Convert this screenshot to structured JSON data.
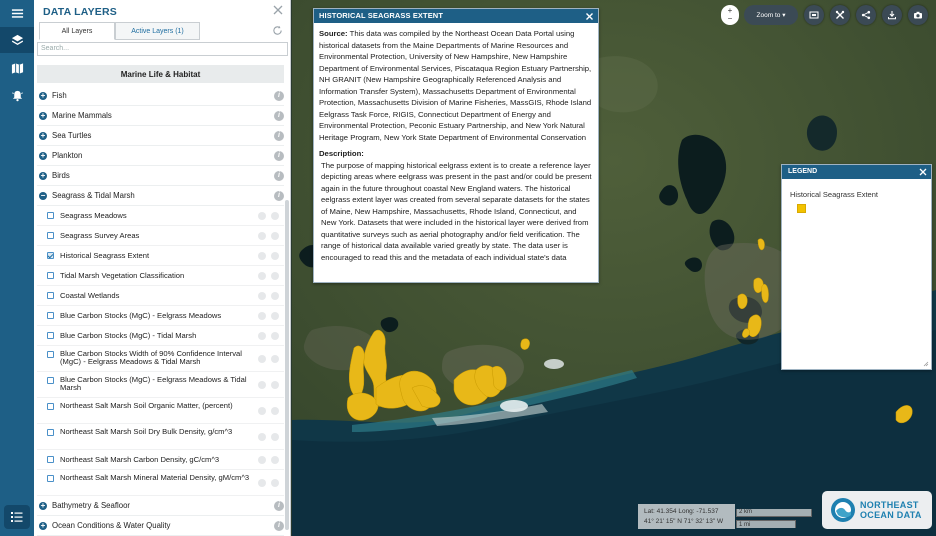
{
  "panel": {
    "title": "DATA LAYERS",
    "tabs": [
      "All Layers",
      "Active Layers (1)"
    ],
    "search_placeholder": "Search...",
    "category_header": "Marine Life & Habitat",
    "categories_top": [
      "Fish",
      "Marine Mammals",
      "Sea Turtles",
      "Plankton",
      "Birds"
    ],
    "expanded_category": "Seagrass & Tidal Marsh",
    "sublayers": [
      {
        "label": "Seagrass Meadows",
        "checked": false
      },
      {
        "label": "Seagrass Survey Areas",
        "checked": false
      },
      {
        "label": "Historical Seagrass Extent",
        "checked": true
      },
      {
        "label": "Tidal Marsh Vegetation Classification",
        "checked": false
      },
      {
        "label": "Coastal Wetlands",
        "checked": false
      },
      {
        "label": "Blue Carbon Stocks (MgC) - Eelgrass Meadows",
        "checked": false
      },
      {
        "label": "Blue Carbon Stocks (MgC) - Tidal Marsh",
        "checked": false
      },
      {
        "label": "Blue Carbon Stocks Width of 90% Confidence Interval (MgC) - Eelgrass Meadows & Tidal Marsh",
        "checked": false
      },
      {
        "label": "Blue Carbon Stocks (MgC) - Eelgrass Meadows & Tidal Marsh",
        "checked": false
      },
      {
        "label": "Northeast Salt Marsh Soil Organic Matter, (percent)",
        "checked": false
      },
      {
        "label": "Northeast Salt Marsh Soil Dry Bulk Density, g/cm^3",
        "checked": false
      },
      {
        "label": "Northeast Salt Marsh Carbon Density, gC/cm^3",
        "checked": false
      },
      {
        "label": "Northeast Salt Marsh Mineral Material Density, gM/cm^3",
        "checked": false
      }
    ],
    "categories_bottom": [
      "Bathymetry & Seafloor",
      "Ocean Conditions & Water Quality"
    ]
  },
  "popup": {
    "title": "HISTORICAL SEAGRASS EXTENT",
    "source_label": "Source:",
    "source_text": "This data was compiled by the Northeast Ocean Data Portal using historical datasets from the Maine Departments of Marine Resources and Environmental Protection, University of New Hampshire, New Hampshire Department of Environmental Services, Piscataqua Region Estuary Partnership, NH GRANIT (New Hampshire Geographically Referenced Analysis and Information Transfer System), Massachusetts Department of Environmental Protection, Massachusetts Division of Marine Fisheries, MassGIS, Rhode Island Eelgrass Task Force, RIGIS, Connecticut Department of Energy and Environmental Protection, Peconic Estuary Partnership, and New York Natural Heritage Program, New York State Department of Environmental Conservation",
    "description_label": "Description:",
    "description_text": "The purpose of mapping historical eelgrass extent is to create a reference layer depicting areas where eelgrass was present in the past and/or could be present again in the future throughout coastal New England waters. The historical eelgrass extent layer was created from several separate datasets for the states of Maine, New Hampshire, Massachusetts, Rhode Island, Connecticut, and New York. Datasets that were included in the historical layer were derived from quantitative surveys such as aerial photography and/or field verification. The range of historical data available varied greatly by state. The data user is encouraged to read this and the metadata of each individual state's data"
  },
  "legend": {
    "title": "LEGEND",
    "item": "Historical Seagrass Extent",
    "swatch_color": "#f2c200"
  },
  "toolbar": {
    "zoom_label": "Zoom to"
  },
  "coords": {
    "latlong": "Lat: 41.354 Long: -71.537",
    "dms": "41° 21' 15\" N 71° 32' 13\" W"
  },
  "scale": {
    "km": "2 km",
    "mi": "1 mi"
  },
  "logo": {
    "line1": "NORTHEAST",
    "line2": "OCEAN DATA"
  },
  "colors": {
    "brand": "#1e5f86",
    "seagrass": "#f2c200"
  }
}
